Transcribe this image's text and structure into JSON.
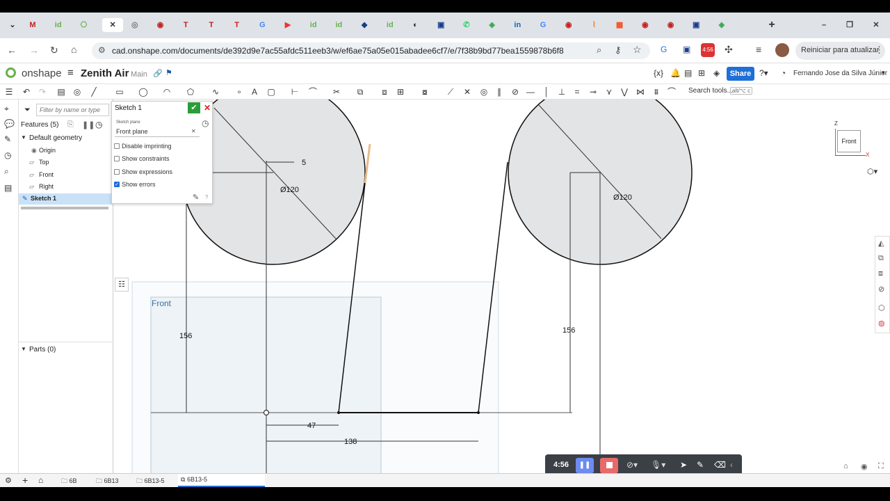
{
  "browser": {
    "tabs": [
      "M",
      "id",
      "⎔",
      "✕",
      "◎",
      "◉",
      "T",
      "T",
      "T",
      "G",
      "▶",
      "id",
      "id",
      "◆",
      "id",
      "◐",
      "▣",
      "✆",
      "◈",
      "in",
      "G",
      "◉",
      "⌇",
      "▦",
      "◉",
      "◉",
      "▣",
      "◈"
    ],
    "new_tab": "+",
    "url": "cad.onshape.com/documents/de392d9e7ac55afdc511eeb3/w/ef6ae75a05e015abadee6cf7/e/7f38b9bd77bea1559878b6f8",
    "badge": "4:56",
    "update_label": "Reiniciar para atualizar"
  },
  "app": {
    "logo": "onshape",
    "doc_title": "Zenith Air",
    "branch": "Main",
    "share_label": "Share",
    "user_name": "Fernando Jose da Silva Júnior",
    "search_tools": "Search tools...",
    "search_shortcut": "alt/⌥ c"
  },
  "features": {
    "filter_placeholder": "Filter by name or type",
    "title": "Features (5)",
    "group": "Default geometry",
    "items": [
      "Origin",
      "Top",
      "Front",
      "Right",
      "Sketch 1"
    ],
    "parts": "Parts (0)"
  },
  "sketch_dialog": {
    "title": "Sketch 1",
    "plane_label": "Sketch plane",
    "plane_value": "Front plane",
    "options": [
      {
        "label": "Disable imprinting",
        "checked": false
      },
      {
        "label": "Show constraints",
        "checked": false
      },
      {
        "label": "Show expressions",
        "checked": false
      },
      {
        "label": "Show errors",
        "checked": true
      }
    ]
  },
  "viewcube": {
    "face": "Front",
    "z": "Z",
    "x": "X"
  },
  "canvas": {
    "plane_label": "Front",
    "dims": [
      "5",
      "Ø120",
      "Ø120",
      "156",
      "156",
      "47",
      "138"
    ]
  },
  "recorder": {
    "time": "4:56"
  },
  "bottom_tabs": [
    "6B",
    "6B13",
    "6B13-5",
    "6B13-5"
  ]
}
